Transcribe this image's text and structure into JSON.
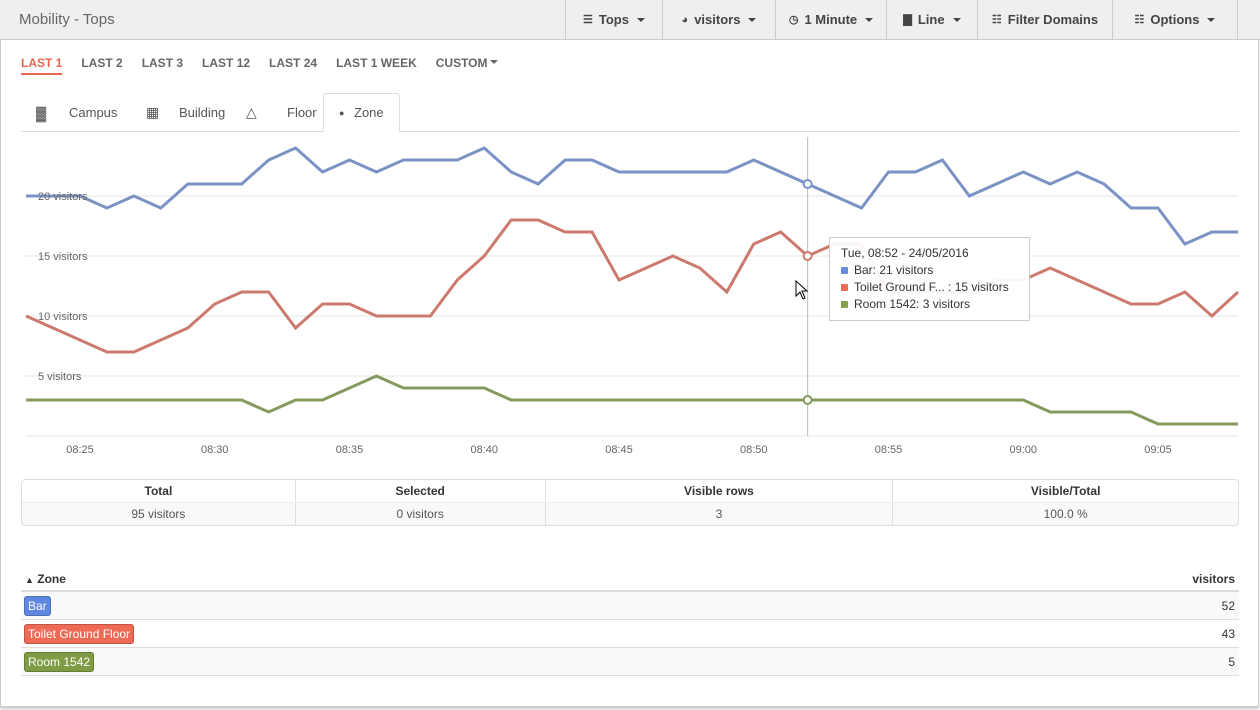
{
  "header": {
    "title": "Mobility - Tops",
    "toolbar": [
      {
        "label": "Tops",
        "icon": "server-icon",
        "dropdown": true
      },
      {
        "label": "visitors",
        "icon": "dashboard-icon",
        "dropdown": true
      },
      {
        "label": "1 Minute",
        "icon": "clock-icon",
        "dropdown": true
      },
      {
        "label": "Line",
        "icon": "bar-chart-icon",
        "dropdown": true
      },
      {
        "label": "Filter Domains",
        "icon": "list-icon",
        "dropdown": false
      },
      {
        "label": "Options",
        "icon": "grid-icon",
        "dropdown": true
      }
    ]
  },
  "ranges": {
    "items": [
      "LAST 1",
      "LAST 2",
      "LAST 3",
      "LAST 12",
      "LAST 24",
      "LAST 1 WEEK",
      "CUSTOM"
    ],
    "active": "LAST 1",
    "accent": "#e8654f"
  },
  "tabs": [
    {
      "label": "Campus",
      "icon": "campus-icon"
    },
    {
      "label": "Building",
      "icon": "building-icon"
    },
    {
      "label": "Floor",
      "icon": "floor-map-icon"
    },
    {
      "label": "Zone",
      "icon": "map-marker-icon",
      "active": true
    }
  ],
  "chart_data": {
    "type": "line",
    "x": [
      "08:23",
      "08:24",
      "08:25",
      "08:26",
      "08:27",
      "08:28",
      "08:29",
      "08:30",
      "08:31",
      "08:32",
      "08:33",
      "08:34",
      "08:35",
      "08:36",
      "08:37",
      "08:38",
      "08:39",
      "08:40",
      "08:41",
      "08:42",
      "08:43",
      "08:44",
      "08:45",
      "08:46",
      "08:47",
      "08:48",
      "08:49",
      "08:50",
      "08:51",
      "08:52",
      "08:53",
      "08:54",
      "08:55",
      "08:56",
      "08:57",
      "08:58",
      "08:59",
      "09:00",
      "09:01",
      "09:02",
      "09:03",
      "09:04",
      "09:05",
      "09:06",
      "09:07",
      "09:08"
    ],
    "xticks": [
      "08:25",
      "08:30",
      "08:35",
      "08:40",
      "08:45",
      "08:50",
      "08:55",
      "09:00",
      "09:05"
    ],
    "yticks": [
      {
        "value": 5,
        "label": "5 visitors"
      },
      {
        "value": 10,
        "label": "10 visitors"
      },
      {
        "value": 15,
        "label": "15 visitors"
      },
      {
        "value": 20,
        "label": "20 visitors"
      }
    ],
    "ylim": [
      0,
      25
    ],
    "grid": true,
    "series": [
      {
        "name": "Bar",
        "color": "#7a92c4",
        "values": [
          20,
          20,
          20,
          19,
          20,
          19,
          21,
          21,
          21,
          23,
          24,
          22,
          23,
          22,
          23,
          23,
          23,
          24,
          22,
          21,
          23,
          23,
          22,
          22,
          22,
          22,
          22,
          23,
          22,
          21,
          20,
          19,
          22,
          22,
          23,
          20,
          21,
          22,
          21,
          22,
          21,
          19,
          19,
          16,
          17,
          17
        ]
      },
      {
        "name": "Toilet Ground Floor",
        "color": "#cc7a6e",
        "values": [
          10,
          9,
          8,
          7,
          7,
          8,
          9,
          11,
          12,
          12,
          9,
          11,
          11,
          10,
          10,
          10,
          13,
          15,
          18,
          18,
          17,
          17,
          13,
          14,
          15,
          14,
          12,
          16,
          17,
          15,
          16,
          16,
          12,
          12,
          12,
          12,
          13,
          13,
          14,
          13,
          12,
          11,
          11,
          12,
          10,
          12
        ]
      },
      {
        "name": "Room 1542",
        "color": "#869a5e",
        "values": [
          3,
          3,
          3,
          3,
          3,
          3,
          3,
          3,
          3,
          2,
          3,
          3,
          4,
          5,
          4,
          4,
          4,
          4,
          3,
          3,
          3,
          3,
          3,
          3,
          3,
          3,
          3,
          3,
          3,
          3,
          3,
          3,
          3,
          3,
          3,
          3,
          3,
          3,
          2,
          2,
          2,
          2,
          1,
          1,
          1,
          1
        ]
      }
    ],
    "hover": {
      "x": "08:52",
      "title": "Tue, 08:52 - 24/05/2016",
      "items": [
        {
          "text": "Bar: 21 visitors",
          "color": "#6a8bdb"
        },
        {
          "text": "Toilet Ground F... : 15 visitors",
          "color": "#ee6a55"
        },
        {
          "text": "Room 1542: 3 visitors",
          "color": "#86a04c"
        }
      ]
    }
  },
  "summary": {
    "headers": [
      "Total",
      "Selected",
      "Visible rows",
      "Visible/Total"
    ],
    "values": [
      "95 visitors",
      "0 visitors",
      "3",
      "100.0 %"
    ]
  },
  "zones": {
    "headers": [
      "Zone",
      "visitors"
    ],
    "rows": [
      {
        "name": "Bar",
        "value": "52",
        "color": "#5f87e0"
      },
      {
        "name": "Toilet Ground Floor",
        "value": "43",
        "color": "#ee6a55"
      },
      {
        "name": "Room 1542",
        "value": "5",
        "color": "#7f9c44"
      }
    ]
  }
}
